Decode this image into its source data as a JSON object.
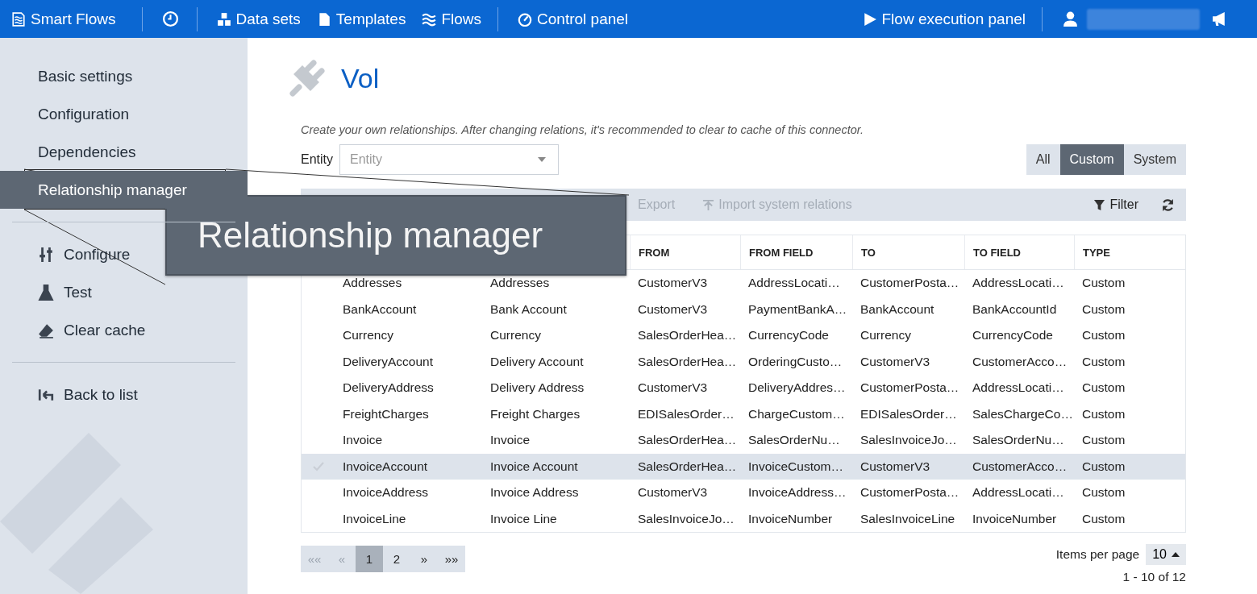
{
  "topbar": {
    "brand": "Smart Flows",
    "items": [
      {
        "label": "Data sets"
      },
      {
        "label": "Templates"
      },
      {
        "label": "Flows"
      }
    ],
    "control_panel": "Control panel",
    "execution_panel": "Flow execution panel"
  },
  "sidebar": {
    "settings": [
      {
        "label": "Basic settings",
        "selected": false
      },
      {
        "label": "Configuration",
        "selected": false
      },
      {
        "label": "Dependencies",
        "selected": false
      },
      {
        "label": "Relationship manager",
        "selected": true
      }
    ],
    "actions": [
      {
        "label": "Configure"
      },
      {
        "label": "Test"
      },
      {
        "label": "Clear cache"
      }
    ],
    "back": "Back to list"
  },
  "callout": {
    "text": "Relationship manager"
  },
  "page": {
    "title": "Vol",
    "description": "Create your own relationships. After changing relations, it's recommended to clear to cache of this connector.",
    "entity": {
      "label": "Entity",
      "placeholder": "Entity"
    },
    "scope_tabs": [
      {
        "label": "All",
        "selected": false
      },
      {
        "label": "Custom",
        "selected": true
      },
      {
        "label": "System",
        "selected": false
      }
    ],
    "toolbar": {
      "export": "Export",
      "import": "Import system relations",
      "filter": "Filter"
    }
  },
  "table": {
    "columns": [
      "",
      "",
      "FROM",
      "FROM FIELD",
      "TO",
      "TO FIELD",
      "TYPE"
    ],
    "rows": [
      {
        "selected": false,
        "cells": [
          "Addresses",
          "Addresses",
          "CustomerV3",
          "AddressLocati…",
          "CustomerPosta…",
          "AddressLocati…",
          "Custom"
        ]
      },
      {
        "selected": false,
        "cells": [
          "BankAccount",
          "Bank Account",
          "CustomerV3",
          "PaymentBankA…",
          "BankAccount",
          "BankAccountId",
          "Custom"
        ]
      },
      {
        "selected": false,
        "cells": [
          "Currency",
          "Currency",
          "SalesOrderHea…",
          "CurrencyCode",
          "Currency",
          "CurrencyCode",
          "Custom"
        ]
      },
      {
        "selected": false,
        "cells": [
          "DeliveryAccount",
          "Delivery Account",
          "SalesOrderHea…",
          "OrderingCusto…",
          "CustomerV3",
          "CustomerAcco…",
          "Custom"
        ]
      },
      {
        "selected": false,
        "cells": [
          "DeliveryAddress",
          "Delivery Address",
          "CustomerV3",
          "DeliveryAddres…",
          "CustomerPosta…",
          "AddressLocati…",
          "Custom"
        ]
      },
      {
        "selected": false,
        "cells": [
          "FreightCharges",
          "Freight Charges",
          "EDISalesOrder…",
          "ChargeCustom…",
          "EDISalesOrder…",
          "SalesChargeCo…",
          "Custom"
        ]
      },
      {
        "selected": false,
        "cells": [
          "Invoice",
          "Invoice",
          "SalesOrderHea…",
          "SalesOrderNu…",
          "SalesInvoiceJo…",
          "SalesOrderNu…",
          "Custom"
        ]
      },
      {
        "selected": true,
        "cells": [
          "InvoiceAccount",
          "Invoice Account",
          "SalesOrderHea…",
          "InvoiceCustom…",
          "CustomerV3",
          "CustomerAcco…",
          "Custom"
        ]
      },
      {
        "selected": false,
        "cells": [
          "InvoiceAddress",
          "Invoice Address",
          "CustomerV3",
          "InvoiceAddress…",
          "CustomerPosta…",
          "AddressLocati…",
          "Custom"
        ]
      },
      {
        "selected": false,
        "cells": [
          "InvoiceLine",
          "Invoice Line",
          "SalesInvoiceJo…",
          "InvoiceNumber",
          "SalesInvoiceLine",
          "InvoiceNumber",
          "Custom"
        ]
      }
    ]
  },
  "pagination": {
    "first": "««",
    "prev": "«",
    "pages": [
      {
        "label": "1",
        "selected": true
      },
      {
        "label": "2",
        "selected": false
      }
    ],
    "next": "»",
    "last": "»»",
    "items_per_page_label": "Items per page",
    "items_per_page": "10",
    "range": "1 - 10 of 12"
  }
}
